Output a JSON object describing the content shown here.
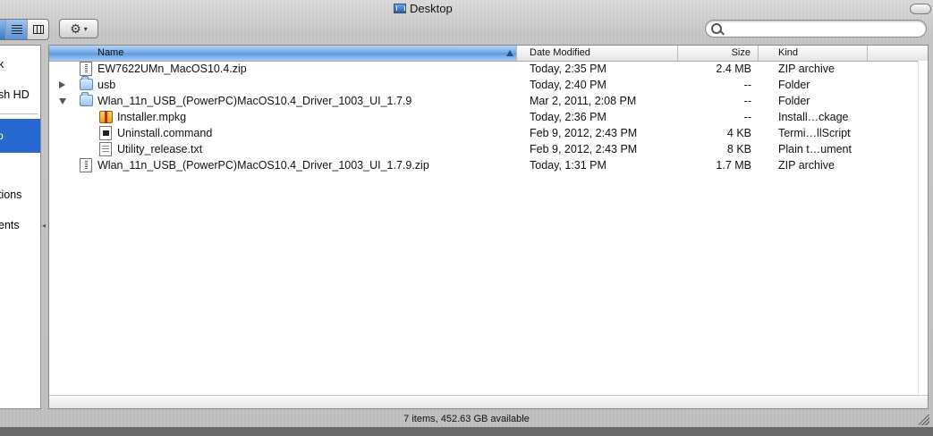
{
  "window": {
    "title": "Desktop"
  },
  "search": {
    "placeholder": "",
    "value": ""
  },
  "sidebar": {
    "items": [
      {
        "label": "k"
      },
      {
        "label": "sh HD"
      },
      {
        "label": "p"
      },
      {
        "label": "tions"
      },
      {
        "label": "ents"
      }
    ]
  },
  "columns": {
    "name": "Name",
    "date": "Date Modified",
    "size": "Size",
    "kind": "Kind"
  },
  "rows": [
    {
      "name": "EW7622UMn_MacOS10.4.zip",
      "date": "Today, 2:35 PM",
      "size": "2.4 MB",
      "kind": "ZIP archive",
      "icon": "zip-doc-icon",
      "disclosure": "",
      "indent": 0
    },
    {
      "name": "usb",
      "date": "Today, 2:40 PM",
      "size": "--",
      "kind": "Folder",
      "icon": "folder-icon",
      "disclosure": "collapsed",
      "indent": 0
    },
    {
      "name": "Wlan_11n_USB_(PowerPC)MacOS10.4_Driver_1003_UI_1.7.9",
      "date": "Mar 2, 2011, 2:08 PM",
      "size": "--",
      "kind": "Folder",
      "icon": "folder-icon",
      "disclosure": "expanded",
      "indent": 0
    },
    {
      "name": "Installer.mpkg",
      "date": "Today, 2:36 PM",
      "size": "--",
      "kind": "Install…ckage",
      "icon": "package-icon",
      "disclosure": "",
      "indent": 1
    },
    {
      "name": "Uninstall.command",
      "date": "Feb 9, 2012, 2:43 PM",
      "size": "4 KB",
      "kind": "Termi…llScript",
      "icon": "terminal-script-icon",
      "disclosure": "",
      "indent": 1
    },
    {
      "name": "Utility_release.txt",
      "date": "Feb 9, 2012, 2:43 PM",
      "size": "8 KB",
      "kind": "Plain t…ument",
      "icon": "text-document-icon",
      "disclosure": "",
      "indent": 1
    },
    {
      "name": "Wlan_11n_USB_(PowerPC)MacOS10.4_Driver_1003_UI_1.7.9.zip",
      "date": "Today, 1:31 PM",
      "size": "1.7 MB",
      "kind": "ZIP archive",
      "icon": "zip-doc-icon",
      "disclosure": "",
      "indent": 0
    }
  ],
  "status": {
    "text": "7 items, 452.63 GB available"
  },
  "toolbar": {
    "action_glyph": "⚙",
    "action_caret": "▾"
  }
}
